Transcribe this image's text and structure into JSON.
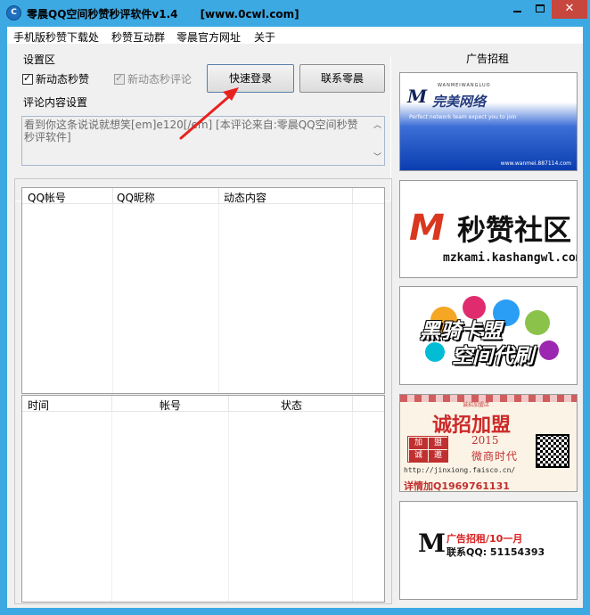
{
  "window": {
    "app_name": "零晨QQ空间秒赞秒评软件v1.4",
    "site": "[www.0cwl.com]",
    "icon_glyph": "C",
    "close_glyph": "✕"
  },
  "menu": {
    "items": [
      "手机版秒赞下载处",
      "秒赞互动群",
      "零晨官方网址",
      "关于"
    ]
  },
  "settings": {
    "group_label": "设置区",
    "new_like_label": "新动态秒赞",
    "new_like_checked": true,
    "new_comment_label": "新动态秒评论",
    "new_comment_checked": true,
    "quick_login_label": "快速登录",
    "contact_label": "联系零晨",
    "comment_group_label": "评论内容设置",
    "comment_text": "看到你这条说说就想笑[em]e120[/em]       [本评论来自:零晨QQ空间秒赞秒评软件]"
  },
  "account_table": {
    "columns": [
      "QQ帐号",
      "QQ昵称",
      "动态内容"
    ]
  },
  "log_table": {
    "columns": [
      "时间",
      "帐号",
      "状态"
    ]
  },
  "ads": {
    "title": "广告招租",
    "ad1": {
      "logo_mark": "M",
      "name": "完美网络",
      "top_small": "WANMEIWANGLUO",
      "slogan": "Perfect network team expect you to join",
      "url": "www.wanmei.887114.com"
    },
    "ad2": {
      "logo_mark": "M",
      "name": "秒赞社区",
      "url": "mzkami.kashangwl.com"
    },
    "ad3": {
      "line1": "黑骑卡盟",
      "line2": "空间代刷"
    },
    "ad4": {
      "top_small": "诚招加盟店",
      "main": "诚招加盟",
      "year": "2015",
      "sub": "微商时代",
      "seal": [
        "加",
        "盟",
        "诚",
        "邀"
      ],
      "site": "http://jinxiong.faisco.cn/",
      "contact": "详情加Q1969761131"
    },
    "ad5": {
      "mark": "M",
      "line1": "广告招租/10一月",
      "line2": "联系QQ: 51154393"
    }
  },
  "colors": {
    "titlebar": "#3da9e3",
    "close_button": "#c7463d",
    "annotation_arrow": "#e8211f"
  }
}
